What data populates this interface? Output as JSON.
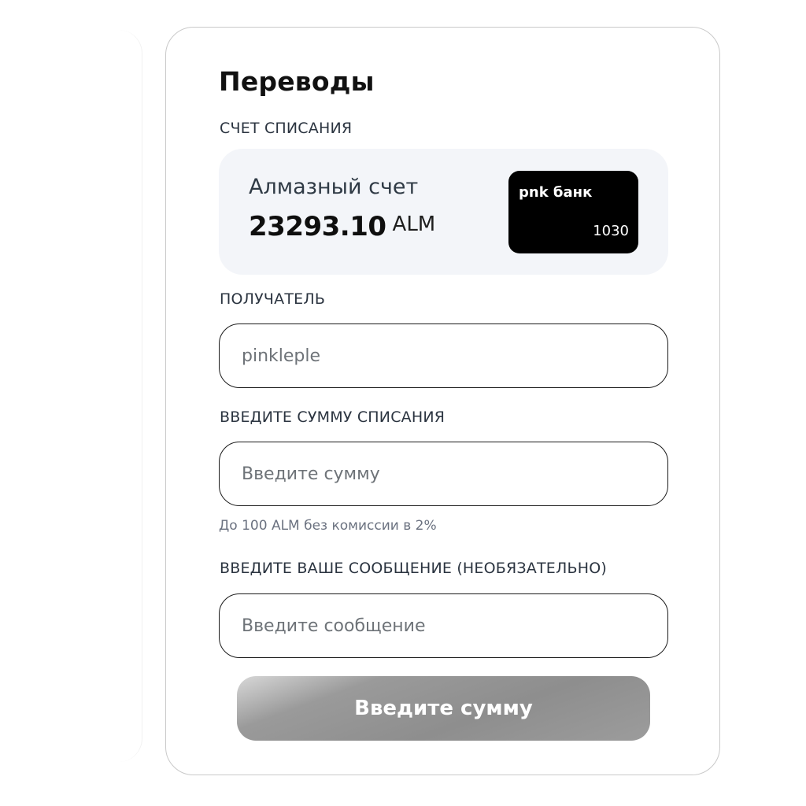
{
  "page": {
    "title": "Переводы"
  },
  "source_account": {
    "label": "СЧЕТ СПИСАНИЯ",
    "name": "Алмазный счет",
    "balance": "23293.10",
    "currency": "ALM",
    "card": {
      "bank_name": "pnk банк",
      "number": "1030"
    }
  },
  "recipient": {
    "label": "ПОЛУЧАТЕЛЬ",
    "value": "pinkleple"
  },
  "amount": {
    "label": "ВВЕДИТЕ СУММУ СПИСАНИЯ",
    "placeholder": "Введите сумму",
    "hint": "До 100 ALM без комиссии в 2%"
  },
  "message": {
    "label": "ВВЕДИТЕ ВАШЕ СООБЩЕНИЕ (НЕОБЯЗАТЕЛЬНО)",
    "placeholder": "Введите сообщение"
  },
  "submit": {
    "label": "Введите сумму"
  },
  "colors": {
    "card_background": "#000000",
    "account_box_background": "#f3f5f9",
    "button_background": "#8e8e8e"
  }
}
